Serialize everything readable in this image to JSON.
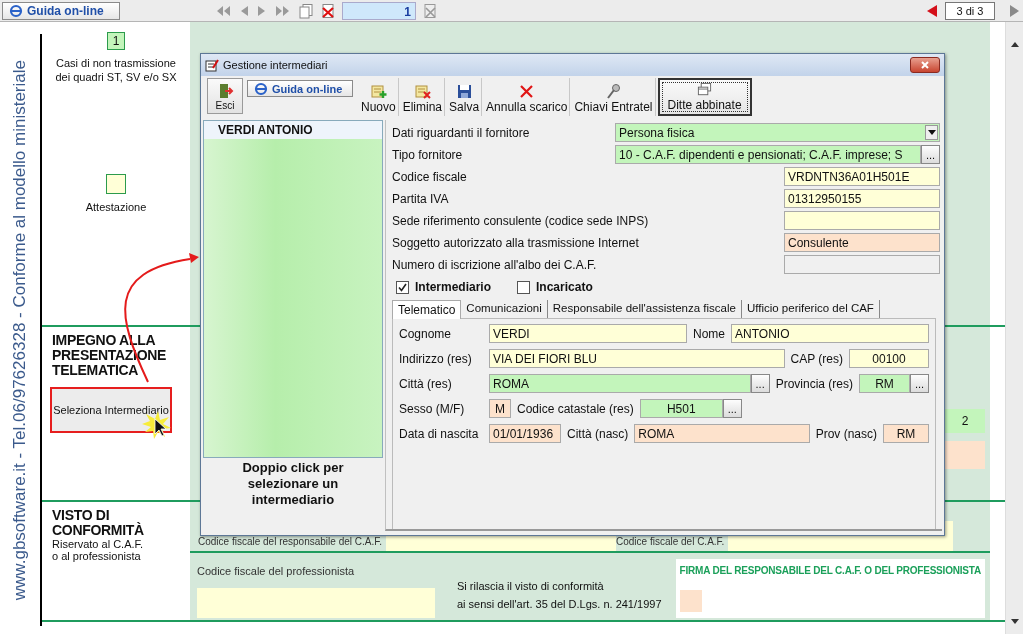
{
  "topbar": {
    "help": "Guida on-line",
    "page_field": "1",
    "page_counter": "3 di 3"
  },
  "side_caption": "www.gbsoftware.it - Tel.06/97626328 - Conforme al modello ministeriale",
  "form": {
    "non_transmission": {
      "value": "1",
      "label": "Casi di non trasmissione\ndei quadri ST, SV e/o SX"
    },
    "attestation": {
      "label": "Attestazione"
    },
    "commitment": {
      "heading": "IMPEGNO ALLA\nPRESENTAZIONE\nTELEMATICA",
      "button": "Seleziona Intermediario",
      "field_value": "2"
    },
    "compliance": {
      "heading": "VISTO DI\nCONFORMITÀ",
      "subheading": "Riservato al C.A.F.\no al professionista",
      "responsible_label": "Codice fiscale del responsabile del C.A.F.",
      "caf_label": "Codice fiscale del C.A.F.",
      "professional_label": "Codice fiscale del professionista",
      "statement": "Si rilascia il visto di conformità\nai sensi dell'art. 35 del D.Lgs. n. 241/1997",
      "signature_label": "FIRMA DEL RESPONSABILE DEL C.A.F. O DEL PROFESSIONISTA"
    }
  },
  "dialog": {
    "title": "Gestione intermediari",
    "toolbar": [
      {
        "kind": "exit",
        "label": "Esci",
        "focused": false
      },
      {
        "kind": "help",
        "label": "Guida on-line",
        "focused": false
      },
      {
        "kind": "new",
        "label": "Nuovo",
        "focused": false
      },
      {
        "kind": "delete",
        "label": "Elimina",
        "focused": false
      },
      {
        "kind": "save",
        "label": "Salva",
        "focused": false
      },
      {
        "kind": "cancel",
        "label": "Annulla scarico",
        "focused": false
      },
      {
        "kind": "key",
        "label": "Chiavi Entratel",
        "focused": false
      },
      {
        "kind": "windows",
        "label": "Ditte abbinate",
        "focused": true
      }
    ],
    "list": {
      "items": [
        {
          "label": "VERDI ANTONIO",
          "selected": true
        }
      ],
      "hint": "Doppio click per selezionare un intermediario"
    },
    "details": [
      {
        "label": "Dati riguardanti il fornitore",
        "value": "Persona fisica",
        "kind": "dropdown",
        "color": "#c3f5bb"
      },
      {
        "label": "Tipo fornitore",
        "value": "10 - C.A.F. dipendenti e pensionati; C.A.F. imprese; S",
        "kind": "lookup",
        "picker": "...",
        "color": "#c3f5bb"
      },
      {
        "label": "Codice fiscale",
        "value": "VRDNTN36A01H501E",
        "kind": "text",
        "color": "#ffffd7"
      },
      {
        "label": "Partita IVA",
        "value": "01312950155",
        "kind": "text",
        "color": "#ffffd7"
      },
      {
        "label": "Sede riferimento consulente (codice sede INPS)",
        "kind": "text",
        "color": "#ffffd7"
      },
      {
        "label": "Soggetto autorizzato alla trasmissione Internet",
        "value": "Consulente",
        "kind": "text",
        "color": "#fde2cc"
      },
      {
        "label": "Numero di iscrizione all'albo dei C.A.F.",
        "kind": "text",
        "color": "#f0f0f0"
      }
    ],
    "checks": [
      {
        "label": "Intermediario",
        "checked": true
      },
      {
        "label": "Incaricato",
        "checked": false
      }
    ],
    "tabs": [
      {
        "label": "Telematico",
        "selected": true
      },
      {
        "label": "Comunicazioni",
        "selected": false
      },
      {
        "label": "Responsabile dell'assistenza fiscale",
        "selected": false
      },
      {
        "label": "Ufficio periferico del CAF",
        "selected": false
      }
    ],
    "tab_rows": [
      [
        {
          "label": "Cognome",
          "value": "VERDI",
          "kind": "wide",
          "color": "#ffffd7"
        },
        {
          "label": "Nome",
          "value": "ANTONIO",
          "kind": "wide",
          "color": "#ffffd7"
        }
      ],
      [
        {
          "label": "Indirizzo (res)",
          "value": "VIA DEI FIORI BLU",
          "kind": "wide",
          "color": "#ffffd7"
        },
        {
          "label": "CAP (res)",
          "value": "00100",
          "kind": "short",
          "color": "#ffffd7"
        }
      ],
      [
        {
          "label": "Città (res)",
          "value": "ROMA",
          "kind": "wide",
          "picker": "...",
          "color": "#c3f5bb"
        },
        {
          "label": "Provincia (res)",
          "value": "RM",
          "kind": "tiny2",
          "picker": "...",
          "color": "#c3f5bb"
        }
      ],
      [
        {
          "label": "Sesso (M/F)",
          "value": "M",
          "kind": "tiny",
          "color": "#fde2cc"
        },
        {
          "label": "Codice catastale (res)",
          "value": "H501",
          "kind": "medium",
          "picker": "...",
          "color": "#c3f5bb"
        }
      ],
      [
        {
          "label": "Data di nascita",
          "value": "01/01/1936",
          "kind": "date",
          "color": "#fde2cc"
        },
        {
          "label": "Città (nasc)",
          "value": "ROMA",
          "kind": "wide",
          "color": "#fde2cc"
        },
        {
          "label": "Prov (nasc)",
          "value": "RM",
          "kind": "short2",
          "color": "#fde2cc"
        }
      ]
    ]
  }
}
